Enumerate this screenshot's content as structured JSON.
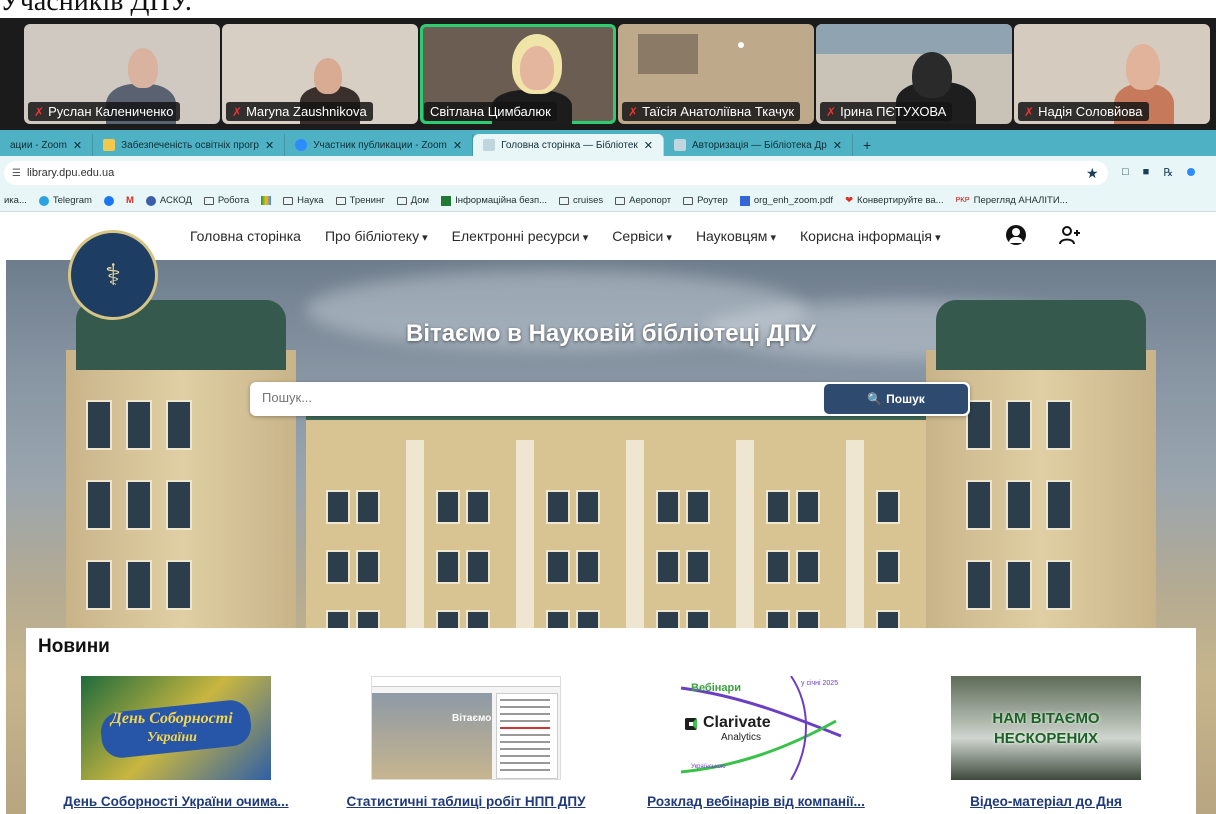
{
  "doc_caption": "Учасників ДПУ.",
  "zoom": {
    "participants": [
      {
        "name": "Руслан Калениченко",
        "muted": true
      },
      {
        "name": "Maryna Zaushnikova",
        "muted": true
      },
      {
        "name": "Світлана Цимбалюк",
        "muted": false,
        "active": true
      },
      {
        "name": "Таїсія Анатоліївна Ткачук",
        "muted": true
      },
      {
        "name": "Ірина ПЄТУХОВА",
        "muted": true
      },
      {
        "name": "Надія Соловйова",
        "muted": true
      }
    ],
    "mute_glyph": "✗"
  },
  "browser": {
    "tabs": [
      {
        "label": "ации - Zoom",
        "close": "✕"
      },
      {
        "label": "Забезпеченість освітніх прогр",
        "close": "✕"
      },
      {
        "label": "Участник публикации - Zoom",
        "close": "✕"
      },
      {
        "label": "Головна сторінка — Бібліотек",
        "close": "✕",
        "active": true
      },
      {
        "label": "Авторизація — Бібліотека Др",
        "close": "✕"
      }
    ],
    "new_tab": "+",
    "url": "library.dpu.edu.ua",
    "star_glyph": "★",
    "bookmarks": [
      "ика...",
      "Telegram",
      "M",
      "АСКОД",
      "Робота",
      "Наука",
      "Тренинг",
      "Дом",
      "Інформаційна безп...",
      "cruises",
      "Аеропорт",
      "Роутер",
      "org_enh_zoom.pdf",
      "Конвертируйте ва...",
      "Перегляд АНАЛІТИ..."
    ]
  },
  "site": {
    "nav": [
      {
        "label": "Головна сторінка",
        "dropdown": false
      },
      {
        "label": "Про бібліотеку",
        "dropdown": true
      },
      {
        "label": "Електронні ресурси",
        "dropdown": true
      },
      {
        "label": "Сервіси",
        "dropdown": true
      },
      {
        "label": "Науковцям",
        "dropdown": true
      },
      {
        "label": "Корисна інформація",
        "dropdown": true
      }
    ],
    "hero_title": "Вітаємо в Науковій бібліотеці ДПУ",
    "search_placeholder": "Пошук...",
    "search_button": "Пошук",
    "news_heading": "Новини",
    "news": [
      {
        "caption": "День Соборності України очима...",
        "thumb_text_1": "День Соборності",
        "thumb_text_2": "України"
      },
      {
        "caption": "Статистичні таблиці робіт НПП ДПУ",
        "thumb_text_1": "Вітаємо"
      },
      {
        "caption": "Розклад вебінарів від компанії...",
        "thumb_text_1": "Вебінари",
        "thumb_text_2": "у січні 2025",
        "thumb_text_3": "Clarivate",
        "thumb_text_4": "Analytics",
        "thumb_text_5": "Українською"
      },
      {
        "caption": "Відео-матеріал до Дня",
        "thumb_text_1": "НАМ ВІТАЄМО",
        "thumb_text_2": "НЕСКОРЕНИХ"
      }
    ]
  }
}
